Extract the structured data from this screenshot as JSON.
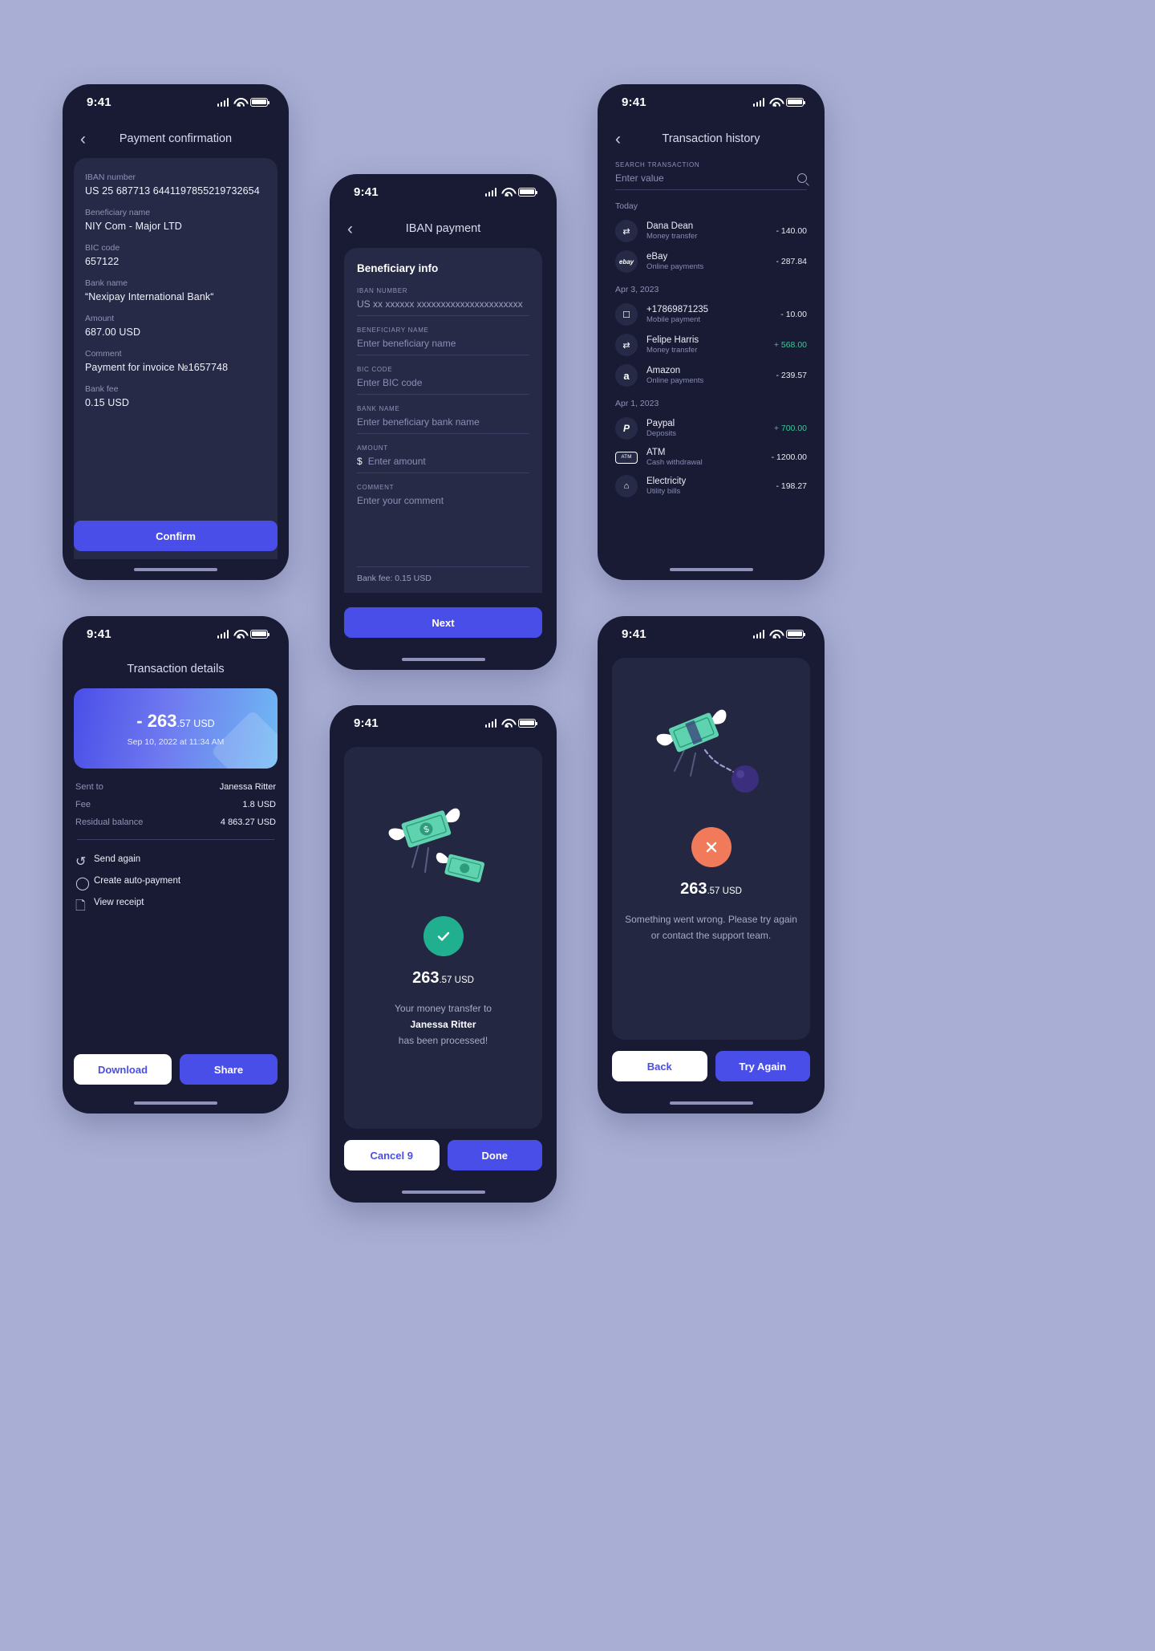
{
  "status_bar": {
    "time": "9:41"
  },
  "screen1": {
    "title": "Payment confirmation",
    "back_icon": "chevron-left-icon",
    "fields": [
      {
        "label": "IBAN number",
        "value": "US 25 687713 6441197855219732654"
      },
      {
        "label": "Beneficiary name",
        "value": "NIY Com - Major LTD"
      },
      {
        "label": "BIC code",
        "value": "657122"
      },
      {
        "label": "Bank name",
        "value": "“Nexipay International Bank“"
      },
      {
        "label": "Amount",
        "value": "687.00 USD"
      },
      {
        "label": "Comment",
        "value": "Payment for invoice №1657748"
      },
      {
        "label": "Bank fee",
        "value": "0.15 USD"
      }
    ],
    "confirm_label": "Confirm"
  },
  "screen2": {
    "title": "IBAN payment",
    "section_title": "Beneficiary info",
    "fields": [
      {
        "label": "IBAN NUMBER",
        "placeholder": "US xx xxxxxx xxxxxxxxxxxxxxxxxxxxxx",
        "prefix": ""
      },
      {
        "label": "BENEFICIARY NAME",
        "placeholder": "Enter beneficiary name",
        "prefix": ""
      },
      {
        "label": "BIC CODE",
        "placeholder": "Enter BIC code",
        "prefix": ""
      },
      {
        "label": "BANK NAME",
        "placeholder": "Enter beneficiary bank name",
        "prefix": ""
      },
      {
        "label": "AMOUNT",
        "placeholder": "Enter amount",
        "prefix": "$"
      },
      {
        "label": "COMMENT",
        "placeholder": "Enter your comment",
        "prefix": ""
      }
    ],
    "bank_fee": "Bank fee: 0.15 USD",
    "next_label": "Next"
  },
  "screen3": {
    "title": "Transaction history",
    "search_label": "SEARCH TRANSACTION",
    "search_placeholder": "Enter value",
    "search_icon": "search-icon",
    "groups": [
      {
        "date": "Today",
        "items": [
          {
            "icon": "transfer-icon",
            "name": "Dana Dean",
            "category": "Money transfer",
            "amount": "- 140.00",
            "positive": false
          },
          {
            "icon": "ebay-icon",
            "name": "eBay",
            "category": "Online payments",
            "amount": "- 287.84",
            "positive": false
          }
        ]
      },
      {
        "date": "Apr  3, 2023",
        "items": [
          {
            "icon": "mobile-icon",
            "name": "+17869871235",
            "category": "Mobile payment",
            "amount": "- 10.00",
            "positive": false
          },
          {
            "icon": "transfer-icon",
            "name": "Felipe Harris",
            "category": "Money transfer",
            "amount": "+ 568.00",
            "positive": true
          },
          {
            "icon": "amazon-icon",
            "name": "Amazon",
            "category": "Online payments",
            "amount": "- 239.57",
            "positive": false
          }
        ]
      },
      {
        "date": "Apr  1, 2023",
        "items": [
          {
            "icon": "paypal-icon",
            "name": "Paypal",
            "category": "Deposits",
            "amount": "+ 700.00",
            "positive": true
          },
          {
            "icon": "atm-icon",
            "name": "ATM",
            "category": "Cash withdrawal",
            "amount": "- 1200.00",
            "positive": false
          },
          {
            "icon": "home-icon",
            "name": "Electricity",
            "category": "Utility bills",
            "amount": "- 198.27",
            "positive": false
          }
        ]
      }
    ]
  },
  "screen4": {
    "title": "Transaction details",
    "amount_main": "- 263",
    "amount_cents": ".57 USD",
    "datetime": "Sep 10, 2022 at 11:34 AM",
    "rows": [
      {
        "key": "Sent to",
        "value": "Janessa Ritter"
      },
      {
        "key": "Fee",
        "value": "1.8 USD"
      },
      {
        "key": "Residual balance",
        "value": "4 863.27 USD"
      }
    ],
    "actions": [
      {
        "icon": "undo-icon",
        "label": "Send again"
      },
      {
        "icon": "clock-icon",
        "label": "Create auto-payment"
      },
      {
        "icon": "document-icon",
        "label": "View receipt"
      }
    ],
    "download_label": "Download",
    "share_label": "Share"
  },
  "screen5": {
    "status_icon": "check-circle-icon",
    "amount_main": "263",
    "amount_cents": ".57 USD",
    "line1": "Your money transfer to",
    "line2": "Janessa Ritter",
    "line3": "has been processed!",
    "cancel_label": "Cancel 9",
    "done_label": "Done"
  },
  "screen6": {
    "status_icon": "error-circle-icon",
    "amount_main": "263",
    "amount_cents": ".57 USD",
    "message_line1": "Something went wrong. Please try again",
    "message_line2": "or contact the support team.",
    "back_label": "Back",
    "try_again_label": "Try Again"
  },
  "colors": {
    "bg": "#a9afd4",
    "phone": "#191b34",
    "card": "#262a47",
    "primary": "#4a4ee8",
    "positive": "#3ec59a",
    "error": "#f07a5a",
    "success": "#21b08f"
  }
}
